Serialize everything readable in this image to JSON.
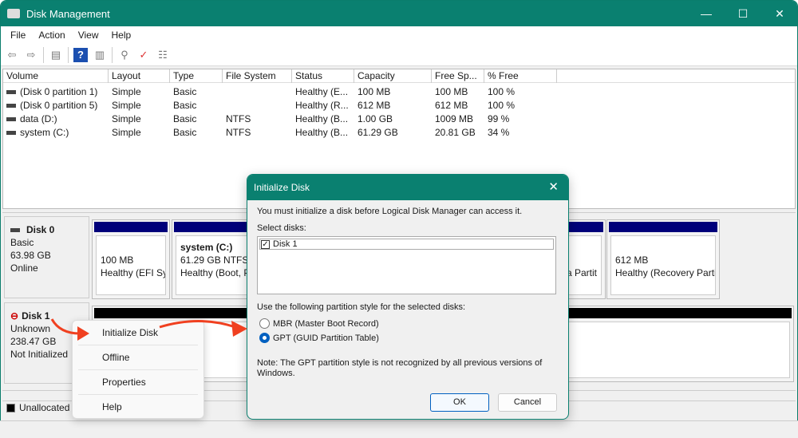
{
  "window": {
    "title": "Disk Management",
    "minimize": "—",
    "maximize": "☐",
    "close": "✕"
  },
  "menu": [
    "File",
    "Action",
    "View",
    "Help"
  ],
  "toolbar": {
    "icons": [
      "back-icon",
      "forward-icon",
      "console-tree-icon",
      "help-icon",
      "action-pane-icon",
      "connect-icon",
      "check-icon",
      "properties-list-icon"
    ]
  },
  "volumes": {
    "columns": [
      "Volume",
      "Layout",
      "Type",
      "File System",
      "Status",
      "Capacity",
      "Free Sp...",
      "% Free"
    ],
    "rows": [
      [
        "(Disk 0 partition 1)",
        "Simple",
        "Basic",
        "",
        "Healthy (E...",
        "100 MB",
        "100 MB",
        "100 %"
      ],
      [
        "(Disk 0 partition 5)",
        "Simple",
        "Basic",
        "",
        "Healthy (R...",
        "612 MB",
        "612 MB",
        "100 %"
      ],
      [
        "data (D:)",
        "Simple",
        "Basic",
        "NTFS",
        "Healthy (B...",
        "1.00 GB",
        "1009 MB",
        "99 %"
      ],
      [
        "system (C:)",
        "Simple",
        "Basic",
        "NTFS",
        "Healthy (B...",
        "61.29 GB",
        "20.81 GB",
        "34 %"
      ]
    ]
  },
  "disks": [
    {
      "name": "Disk 0",
      "type": "Basic",
      "size": "63.98 GB",
      "state": "Online",
      "partitions": [
        {
          "title": "",
          "size": "100 MB",
          "status": "Healthy (EFI Sys"
        },
        {
          "title": "system  (C:)",
          "size": "61.29 GB NTFS",
          "status": "Healthy (Boot, P"
        },
        {
          "title": "",
          "size": "",
          "status": "ta Partit"
        },
        {
          "title": "",
          "size": "612 MB",
          "status": "Healthy (Recovery Parti"
        }
      ]
    },
    {
      "name": "Disk 1",
      "type": "Unknown",
      "size": "238.47 GB",
      "state": "Not Initialized"
    }
  ],
  "legend": {
    "unallocated": "Unallocated"
  },
  "context_menu": [
    "Initialize Disk",
    "Offline",
    "Properties",
    "Help"
  ],
  "dialog": {
    "title": "Initialize Disk",
    "intro": "You must initialize a disk before Logical Disk Manager can access it.",
    "select_label": "Select disks:",
    "disks": [
      {
        "label": "Disk 1",
        "checked": true
      }
    ],
    "style_label": "Use the following partition style for the selected disks:",
    "options": [
      {
        "label": "MBR (Master Boot Record)",
        "selected": false
      },
      {
        "label": "GPT (GUID Partition Table)",
        "selected": true
      }
    ],
    "note": "Note: The GPT partition style is not recognized by all previous versions of Windows.",
    "ok": "OK",
    "cancel": "Cancel"
  },
  "colors": {
    "accent": "#0a8070",
    "partition_bar": "#00007a",
    "annotation_arrow": "#f04020"
  }
}
